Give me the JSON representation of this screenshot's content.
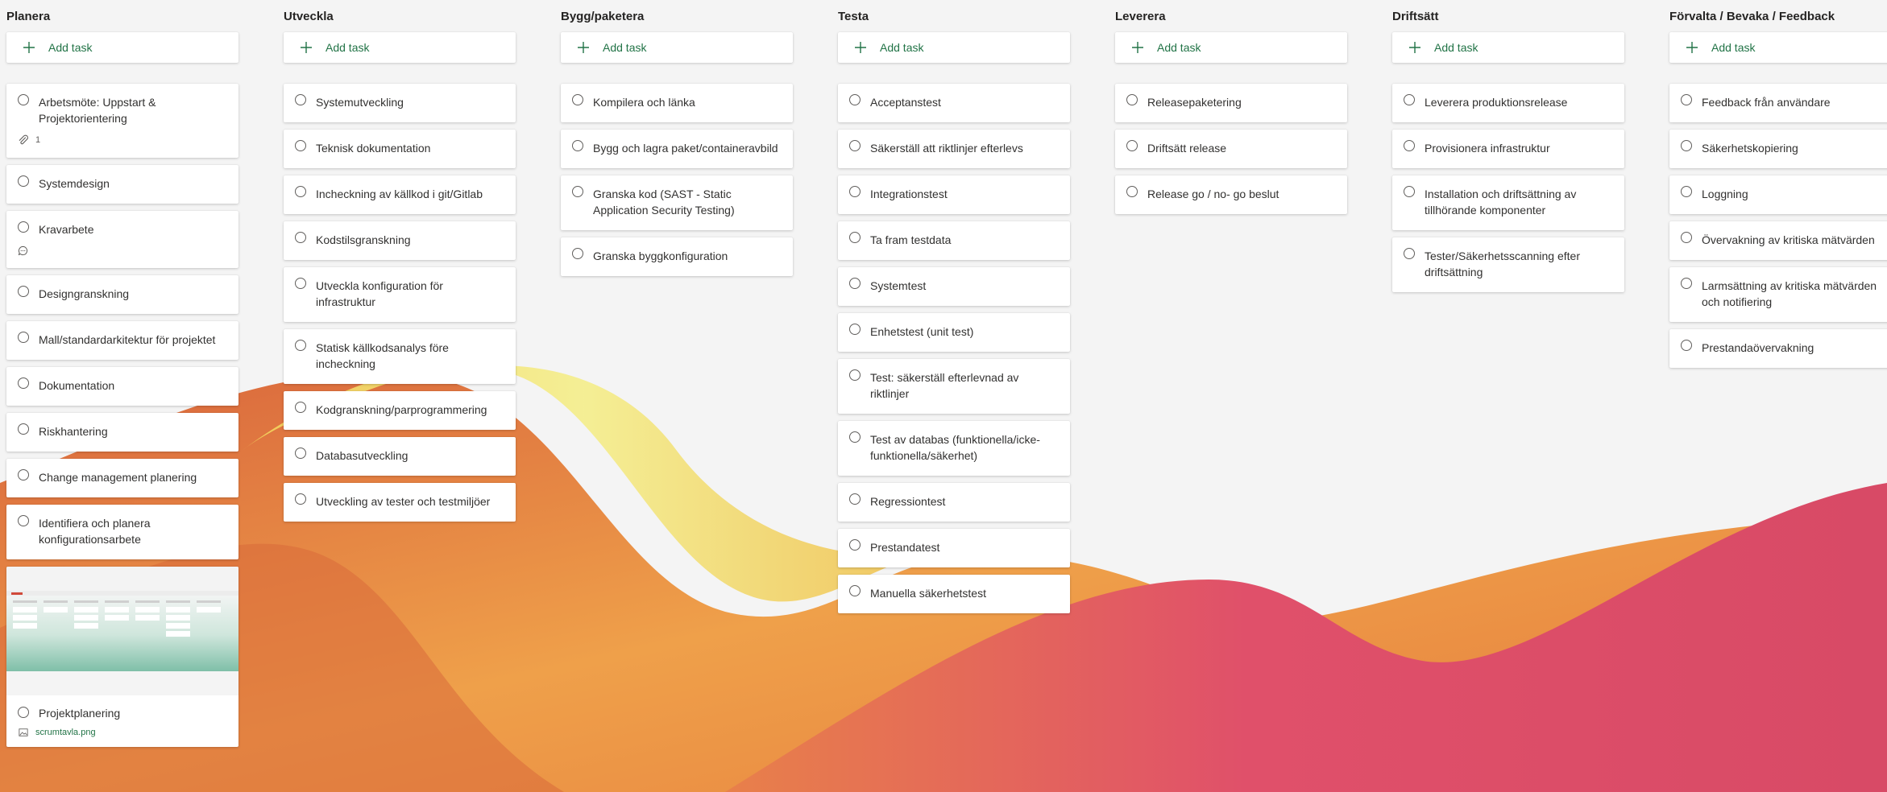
{
  "add_task_label": "Add task",
  "colors": {
    "accent": "#217346",
    "card": "#ffffff",
    "text": "#323130",
    "title": "#252423",
    "background": "#f4f4f4",
    "wave_pink": "#e0506a",
    "wave_orange": "#e58a3a",
    "wave_yellow": "#f2ea6a"
  },
  "columns": [
    {
      "title": "Planera",
      "tasks": [
        {
          "title": "Arbetsmöte: Uppstart & Projektorientering",
          "meta_icon": "paperclip-icon",
          "meta_text": "1"
        },
        {
          "title": "Systemdesign"
        },
        {
          "title": "Kravarbete",
          "meta_icon": "comment-icon"
        },
        {
          "title": "Designgranskning"
        },
        {
          "title": "Mall/standardarkitektur för projektet"
        },
        {
          "title": "Dokumentation"
        },
        {
          "title": "Riskhantering"
        },
        {
          "title": "Change management planering"
        },
        {
          "title": "Identifiera och planera konfigurationsarbete"
        },
        {
          "title": "Projektplanering",
          "image": true,
          "attachment": "scrumtavla.png"
        }
      ]
    },
    {
      "title": "Utveckla",
      "tasks": [
        {
          "title": "Systemutveckling"
        },
        {
          "title": "Teknisk dokumentation"
        },
        {
          "title": "Incheckning av källkod i git/Gitlab"
        },
        {
          "title": "Kodstilsgranskning"
        },
        {
          "title": "Utveckla konfiguration för infrastruktur"
        },
        {
          "title": "Statisk källkodsanalys före incheckning"
        },
        {
          "title": "Kodgranskning/parprogrammering"
        },
        {
          "title": "Databasutveckling"
        },
        {
          "title": "Utveckling av tester och testmiljöer"
        }
      ]
    },
    {
      "title": "Bygg/paketera",
      "tasks": [
        {
          "title": "Kompilera och länka"
        },
        {
          "title": "Bygg och lagra paket/containeravbild"
        },
        {
          "title": "Granska kod (SAST - Static Application Security Testing)"
        },
        {
          "title": "Granska byggkonfiguration"
        }
      ]
    },
    {
      "title": "Testa",
      "tasks": [
        {
          "title": "Acceptanstest"
        },
        {
          "title": "Säkerställ att riktlinjer efterlevs"
        },
        {
          "title": "Integrationstest"
        },
        {
          "title": "Ta fram testdata"
        },
        {
          "title": "Systemtest"
        },
        {
          "title": "Enhetstest (unit test)"
        },
        {
          "title": "Test: säkerställ efterlevnad av riktlinjer"
        },
        {
          "title": "Test av databas (funktionella/icke-funktionella/säkerhet)"
        },
        {
          "title": "Regressiontest"
        },
        {
          "title": "Prestandatest"
        },
        {
          "title": "Manuella säkerhetstest"
        }
      ]
    },
    {
      "title": "Leverera",
      "tasks": [
        {
          "title": "Releasepaketering"
        },
        {
          "title": "Driftsätt release"
        },
        {
          "title": "Release go / no- go beslut"
        }
      ]
    },
    {
      "title": "Driftsätt",
      "tasks": [
        {
          "title": "Leverera produktionsrelease"
        },
        {
          "title": "Provisionera infrastruktur"
        },
        {
          "title": "Installation och driftsättning av tillhörande komponenter"
        },
        {
          "title": "Tester/Säkerhetsscanning efter driftsättning"
        }
      ]
    },
    {
      "title": "Förvalta / Bevaka / Feedback",
      "tasks": [
        {
          "title": "Feedback från användare"
        },
        {
          "title": "Säkerhetskopiering"
        },
        {
          "title": "Loggning"
        },
        {
          "title": "Övervakning av kritiska mätvärden"
        },
        {
          "title": "Larmsättning av kritiska mätvärden och notifiering"
        },
        {
          "title": "Prestandaövervakning"
        }
      ]
    }
  ]
}
